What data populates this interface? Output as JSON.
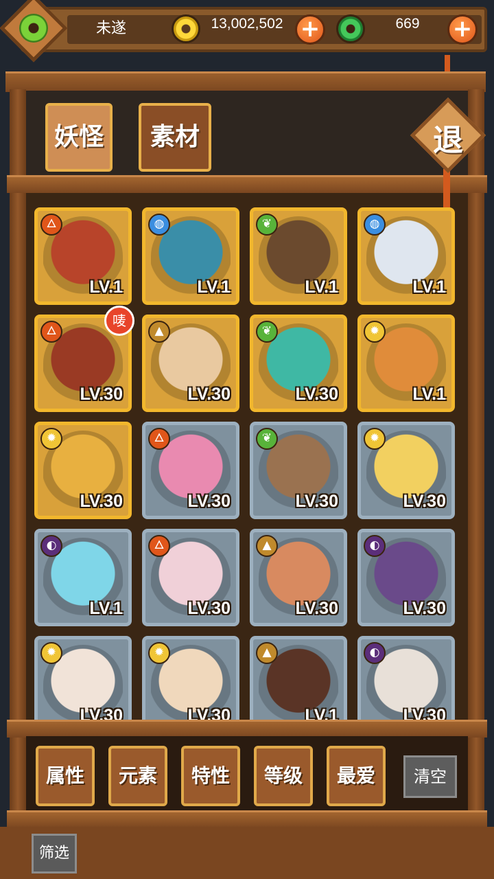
{
  "player": {
    "name": "未遂",
    "gold": "13,002,502",
    "jade": "669"
  },
  "icons": {
    "avatar": "jade-disc-icon",
    "gold": "gold-coin-icon",
    "jade": "jade-coin-icon",
    "add": "plus-icon"
  },
  "tabs": [
    {
      "label": "妖怪",
      "active": true
    },
    {
      "label": "素材",
      "active": false
    }
  ],
  "exit_label": "退",
  "monsters": [
    {
      "element": "fire",
      "level": "LV.1",
      "frame": "gold",
      "color": "#b8442a"
    },
    {
      "element": "water",
      "level": "LV.1",
      "frame": "gold",
      "color": "#3a8ea8"
    },
    {
      "element": "wood",
      "level": "LV.1",
      "frame": "gold",
      "color": "#6b4a2e"
    },
    {
      "element": "water",
      "level": "LV.1",
      "frame": "gold",
      "color": "#dfe6ef"
    },
    {
      "element": "fire",
      "level": "LV.30",
      "frame": "gold",
      "color": "#9a3a24",
      "badge": "唛"
    },
    {
      "element": "earth",
      "level": "LV.30",
      "frame": "gold",
      "color": "#e9c9a0"
    },
    {
      "element": "wood",
      "level": "LV.30",
      "frame": "gold",
      "color": "#3fb8a4"
    },
    {
      "element": "light",
      "level": "LV.1",
      "frame": "gold",
      "color": "#e08c3a"
    },
    {
      "element": "light",
      "level": "LV.30",
      "frame": "gold",
      "color": "#e8b040"
    },
    {
      "element": "fire",
      "level": "LV.30",
      "frame": "silver",
      "color": "#e98ab0"
    },
    {
      "element": "wood",
      "level": "LV.30",
      "frame": "silver",
      "color": "#9a7250"
    },
    {
      "element": "light",
      "level": "LV.30",
      "frame": "silver",
      "color": "#f2d060"
    },
    {
      "element": "dark",
      "level": "LV.1",
      "frame": "silver",
      "color": "#7fd6e8"
    },
    {
      "element": "fire",
      "level": "LV.30",
      "frame": "silver",
      "color": "#f0d0d8"
    },
    {
      "element": "earth",
      "level": "LV.30",
      "frame": "silver",
      "color": "#d88a60"
    },
    {
      "element": "dark",
      "level": "LV.30",
      "frame": "silver",
      "color": "#6a4a8a"
    },
    {
      "element": "light",
      "level": "LV.30",
      "frame": "silver",
      "color": "#f1e3d8"
    },
    {
      "element": "light",
      "level": "LV.30",
      "frame": "silver",
      "color": "#f0d8bc"
    },
    {
      "element": "earth",
      "level": "LV.1",
      "frame": "silver",
      "color": "#5a3426"
    },
    {
      "element": "dark",
      "level": "LV.30",
      "frame": "silver",
      "color": "#e8e0d8"
    }
  ],
  "filters": [
    "属性",
    "元素",
    "特性",
    "等级",
    "最爱"
  ],
  "clear_label": "清空",
  "screen_label": "筛选"
}
